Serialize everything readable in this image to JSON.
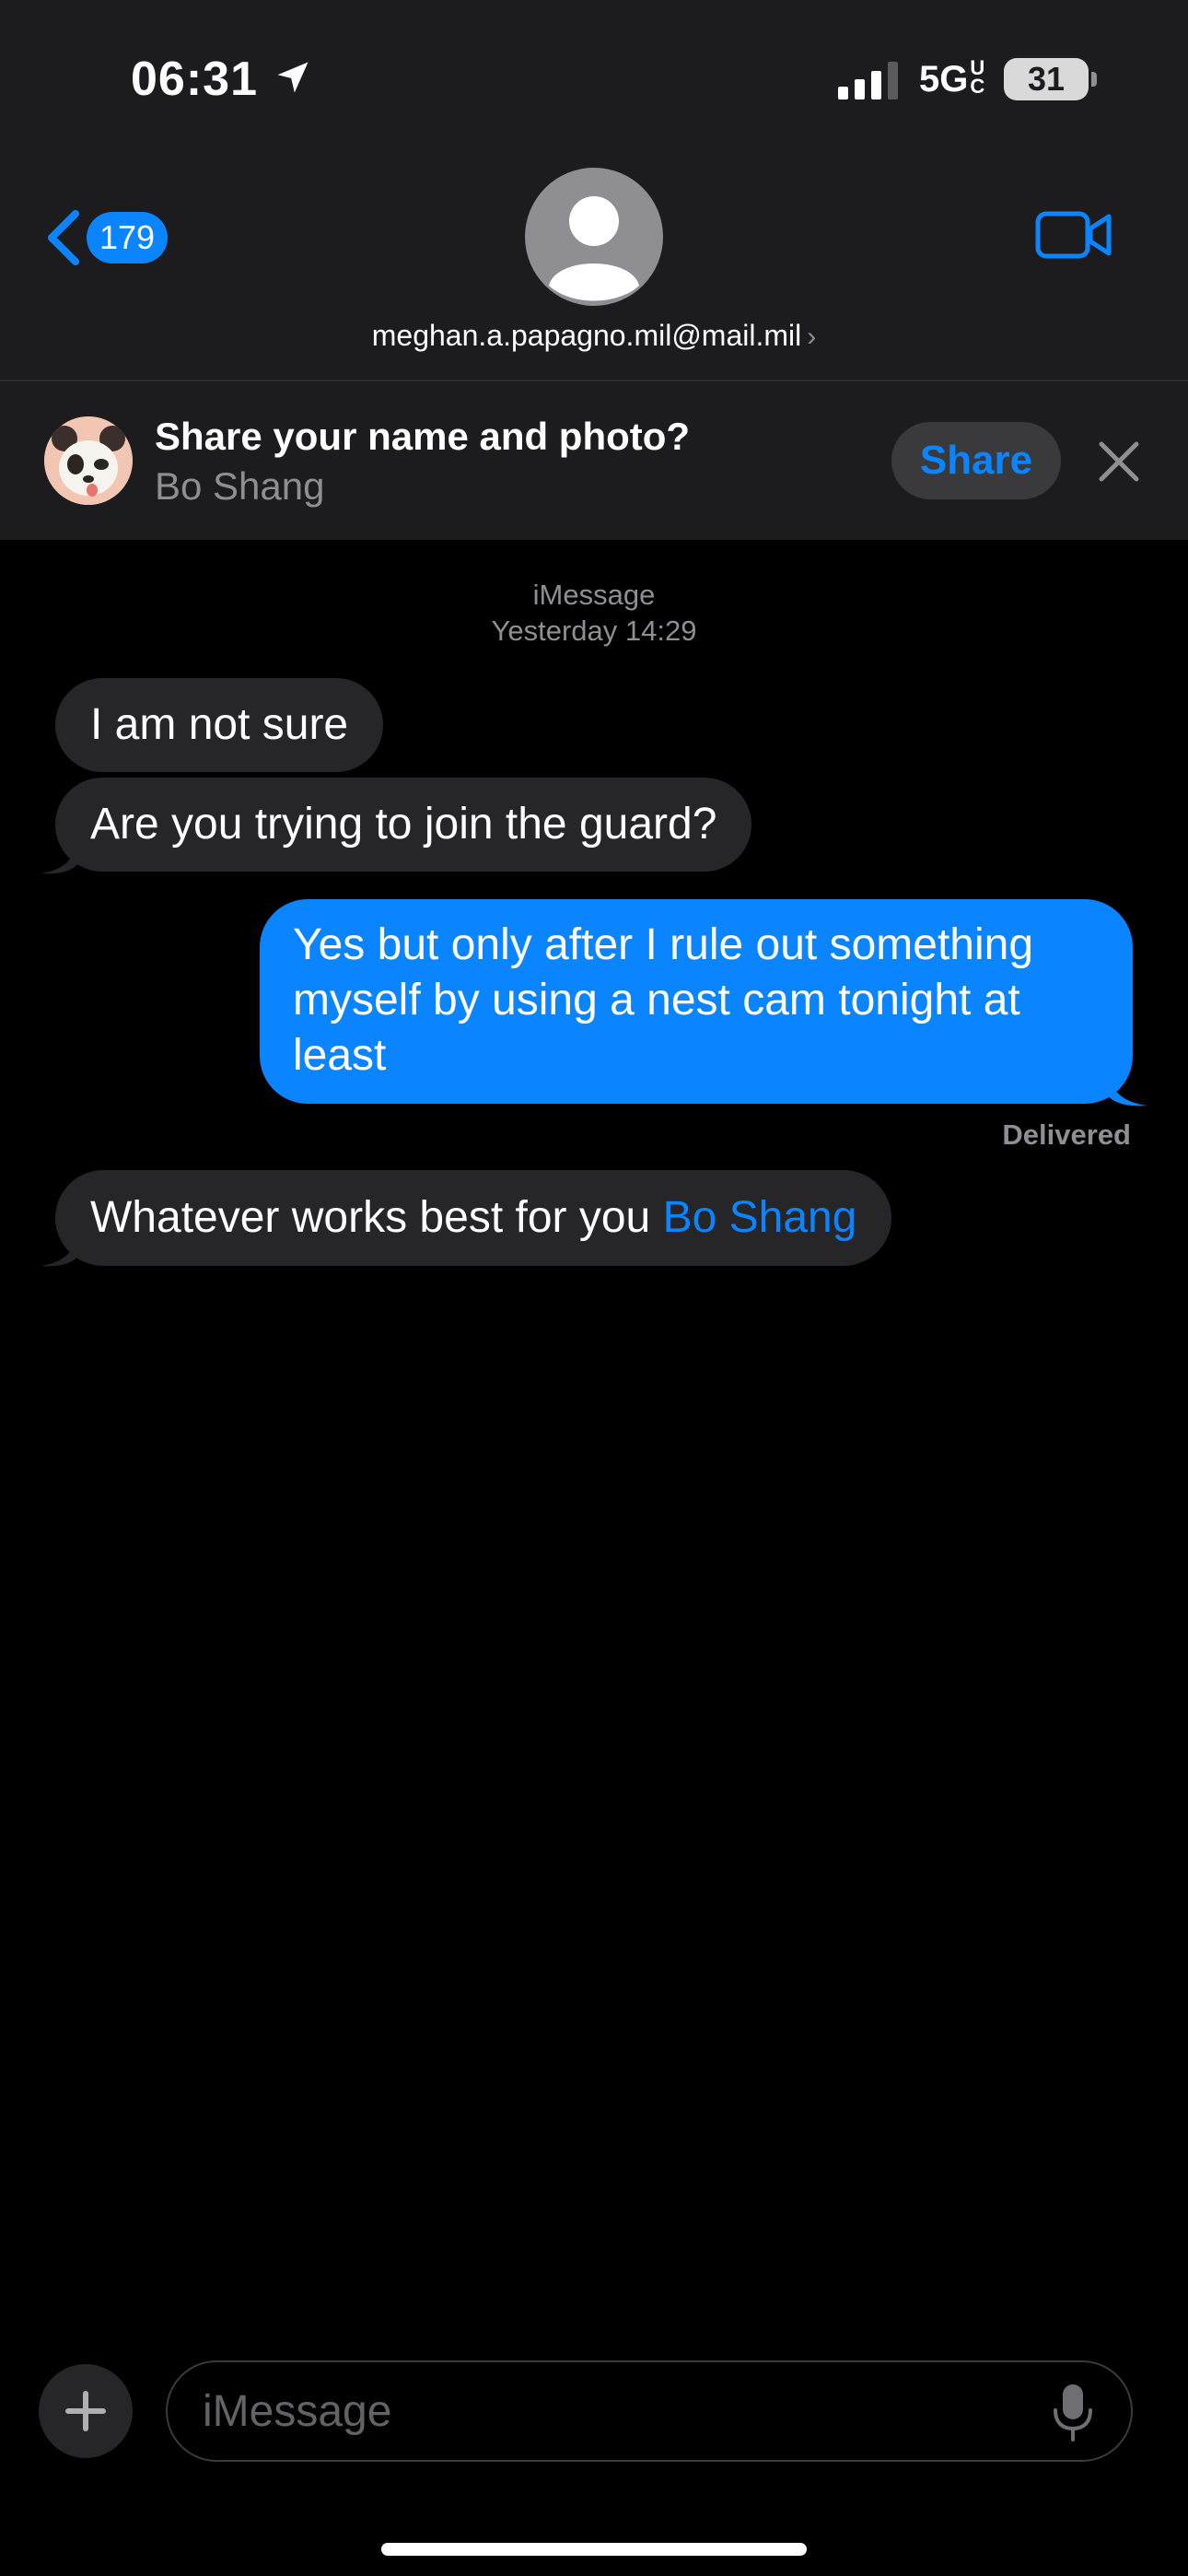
{
  "status_bar": {
    "time": "06:31",
    "network": "5G",
    "network_sub": "UC",
    "battery": "31"
  },
  "nav": {
    "back_badge": "179",
    "contact": "meghan.a.papagno.mil@mail.mil",
    "contact_chevron": "›"
  },
  "share_banner": {
    "title": "Share your name and photo?",
    "name": "Bo Shang",
    "button": "Share"
  },
  "thread": {
    "service": "iMessage",
    "timestamp": "Yesterday 14:29",
    "messages": [
      {
        "direction": "incoming",
        "text": "I am not sure"
      },
      {
        "direction": "incoming",
        "text": "Are you trying to join the guard?"
      },
      {
        "direction": "outgoing",
        "lines": [
          "Yes but only after I rule out something",
          "myself by using a nest cam tonight at",
          "least"
        ]
      },
      {
        "direction": "incoming",
        "text": "Whatever works best for you ",
        "mention": "Bo Shang"
      }
    ],
    "delivered": "Delivered"
  },
  "composer": {
    "placeholder": "iMessage"
  },
  "colors": {
    "accent": "#0a84ff",
    "incoming_bubble": "#262628",
    "header_bg": "#1c1c1e"
  },
  "icons": [
    "location-arrow-icon",
    "signal-icon",
    "battery-icon",
    "back-chevron-icon",
    "person-icon",
    "video-camera-icon",
    "memoji-avatar",
    "close-icon",
    "plus-icon",
    "microphone-icon"
  ]
}
